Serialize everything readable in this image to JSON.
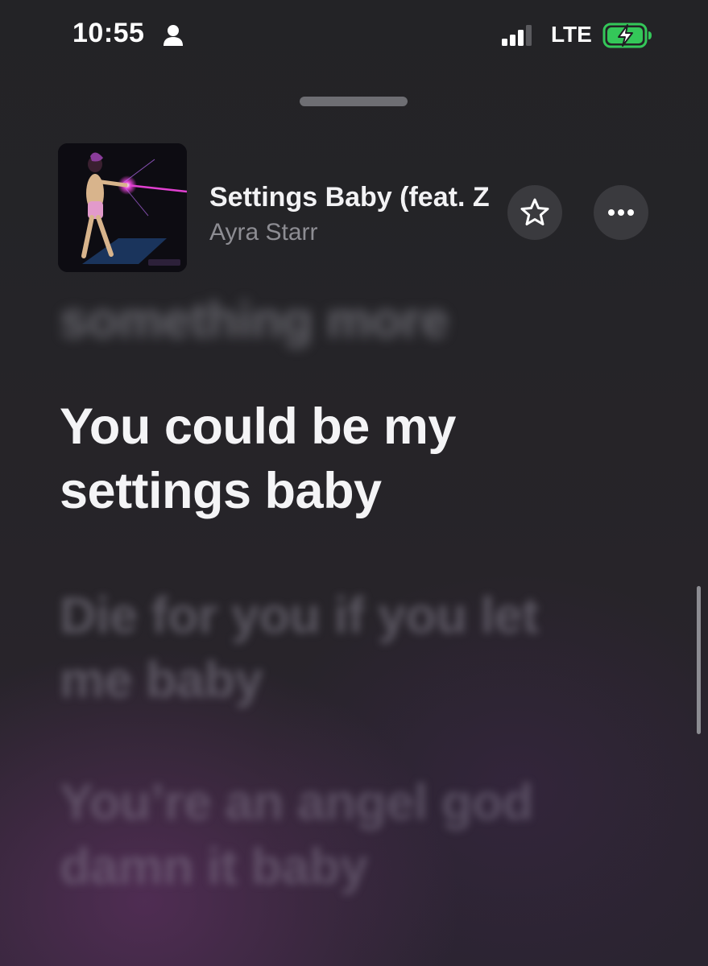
{
  "status_bar": {
    "time": "10:55",
    "network": "LTE"
  },
  "now_playing": {
    "title": "Settings Baby (feat. Z",
    "artist": "Ayra Starr"
  },
  "lyrics": {
    "previous": "something more",
    "current": "You could be my settings baby",
    "next": "Die for you if you let me baby",
    "next2": "You’re an angel god damn it baby"
  },
  "icons": {
    "person": "person-icon",
    "signal": "cellular-signal-icon",
    "battery": "battery-charging-icon",
    "favorite": "star-icon",
    "more": "ellipsis-icon"
  },
  "colors": {
    "battery_charge": "#34c759",
    "artwork_laser": "#e040d0"
  }
}
